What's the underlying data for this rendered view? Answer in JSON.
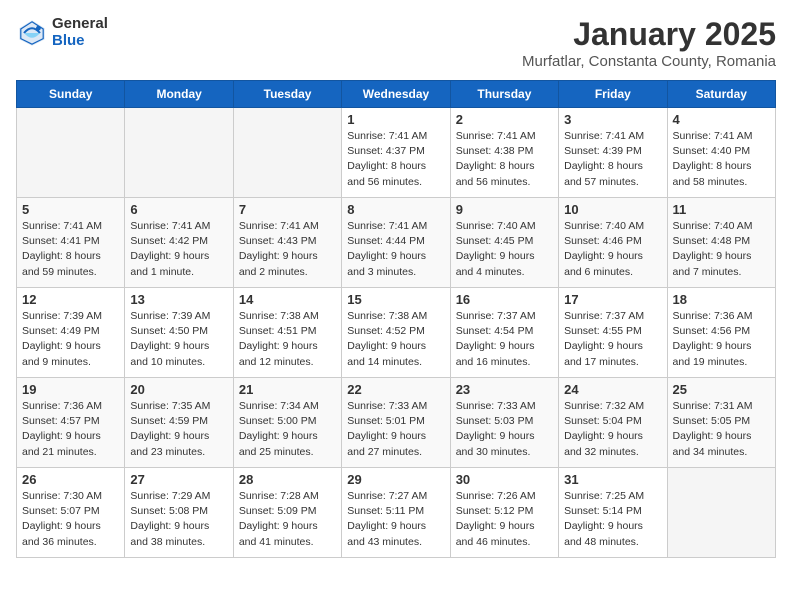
{
  "header": {
    "logo_general": "General",
    "logo_blue": "Blue",
    "month_title": "January 2025",
    "location": "Murfatlar, Constanta County, Romania"
  },
  "days_of_week": [
    "Sunday",
    "Monday",
    "Tuesday",
    "Wednesday",
    "Thursday",
    "Friday",
    "Saturday"
  ],
  "weeks": [
    [
      {
        "day": "",
        "info": ""
      },
      {
        "day": "",
        "info": ""
      },
      {
        "day": "",
        "info": ""
      },
      {
        "day": "1",
        "info": "Sunrise: 7:41 AM\nSunset: 4:37 PM\nDaylight: 8 hours and 56 minutes."
      },
      {
        "day": "2",
        "info": "Sunrise: 7:41 AM\nSunset: 4:38 PM\nDaylight: 8 hours and 56 minutes."
      },
      {
        "day": "3",
        "info": "Sunrise: 7:41 AM\nSunset: 4:39 PM\nDaylight: 8 hours and 57 minutes."
      },
      {
        "day": "4",
        "info": "Sunrise: 7:41 AM\nSunset: 4:40 PM\nDaylight: 8 hours and 58 minutes."
      }
    ],
    [
      {
        "day": "5",
        "info": "Sunrise: 7:41 AM\nSunset: 4:41 PM\nDaylight: 8 hours and 59 minutes."
      },
      {
        "day": "6",
        "info": "Sunrise: 7:41 AM\nSunset: 4:42 PM\nDaylight: 9 hours and 1 minute."
      },
      {
        "day": "7",
        "info": "Sunrise: 7:41 AM\nSunset: 4:43 PM\nDaylight: 9 hours and 2 minutes."
      },
      {
        "day": "8",
        "info": "Sunrise: 7:41 AM\nSunset: 4:44 PM\nDaylight: 9 hours and 3 minutes."
      },
      {
        "day": "9",
        "info": "Sunrise: 7:40 AM\nSunset: 4:45 PM\nDaylight: 9 hours and 4 minutes."
      },
      {
        "day": "10",
        "info": "Sunrise: 7:40 AM\nSunset: 4:46 PM\nDaylight: 9 hours and 6 minutes."
      },
      {
        "day": "11",
        "info": "Sunrise: 7:40 AM\nSunset: 4:48 PM\nDaylight: 9 hours and 7 minutes."
      }
    ],
    [
      {
        "day": "12",
        "info": "Sunrise: 7:39 AM\nSunset: 4:49 PM\nDaylight: 9 hours and 9 minutes."
      },
      {
        "day": "13",
        "info": "Sunrise: 7:39 AM\nSunset: 4:50 PM\nDaylight: 9 hours and 10 minutes."
      },
      {
        "day": "14",
        "info": "Sunrise: 7:38 AM\nSunset: 4:51 PM\nDaylight: 9 hours and 12 minutes."
      },
      {
        "day": "15",
        "info": "Sunrise: 7:38 AM\nSunset: 4:52 PM\nDaylight: 9 hours and 14 minutes."
      },
      {
        "day": "16",
        "info": "Sunrise: 7:37 AM\nSunset: 4:54 PM\nDaylight: 9 hours and 16 minutes."
      },
      {
        "day": "17",
        "info": "Sunrise: 7:37 AM\nSunset: 4:55 PM\nDaylight: 9 hours and 17 minutes."
      },
      {
        "day": "18",
        "info": "Sunrise: 7:36 AM\nSunset: 4:56 PM\nDaylight: 9 hours and 19 minutes."
      }
    ],
    [
      {
        "day": "19",
        "info": "Sunrise: 7:36 AM\nSunset: 4:57 PM\nDaylight: 9 hours and 21 minutes."
      },
      {
        "day": "20",
        "info": "Sunrise: 7:35 AM\nSunset: 4:59 PM\nDaylight: 9 hours and 23 minutes."
      },
      {
        "day": "21",
        "info": "Sunrise: 7:34 AM\nSunset: 5:00 PM\nDaylight: 9 hours and 25 minutes."
      },
      {
        "day": "22",
        "info": "Sunrise: 7:33 AM\nSunset: 5:01 PM\nDaylight: 9 hours and 27 minutes."
      },
      {
        "day": "23",
        "info": "Sunrise: 7:33 AM\nSunset: 5:03 PM\nDaylight: 9 hours and 30 minutes."
      },
      {
        "day": "24",
        "info": "Sunrise: 7:32 AM\nSunset: 5:04 PM\nDaylight: 9 hours and 32 minutes."
      },
      {
        "day": "25",
        "info": "Sunrise: 7:31 AM\nSunset: 5:05 PM\nDaylight: 9 hours and 34 minutes."
      }
    ],
    [
      {
        "day": "26",
        "info": "Sunrise: 7:30 AM\nSunset: 5:07 PM\nDaylight: 9 hours and 36 minutes."
      },
      {
        "day": "27",
        "info": "Sunrise: 7:29 AM\nSunset: 5:08 PM\nDaylight: 9 hours and 38 minutes."
      },
      {
        "day": "28",
        "info": "Sunrise: 7:28 AM\nSunset: 5:09 PM\nDaylight: 9 hours and 41 minutes."
      },
      {
        "day": "29",
        "info": "Sunrise: 7:27 AM\nSunset: 5:11 PM\nDaylight: 9 hours and 43 minutes."
      },
      {
        "day": "30",
        "info": "Sunrise: 7:26 AM\nSunset: 5:12 PM\nDaylight: 9 hours and 46 minutes."
      },
      {
        "day": "31",
        "info": "Sunrise: 7:25 AM\nSunset: 5:14 PM\nDaylight: 9 hours and 48 minutes."
      },
      {
        "day": "",
        "info": ""
      }
    ]
  ]
}
